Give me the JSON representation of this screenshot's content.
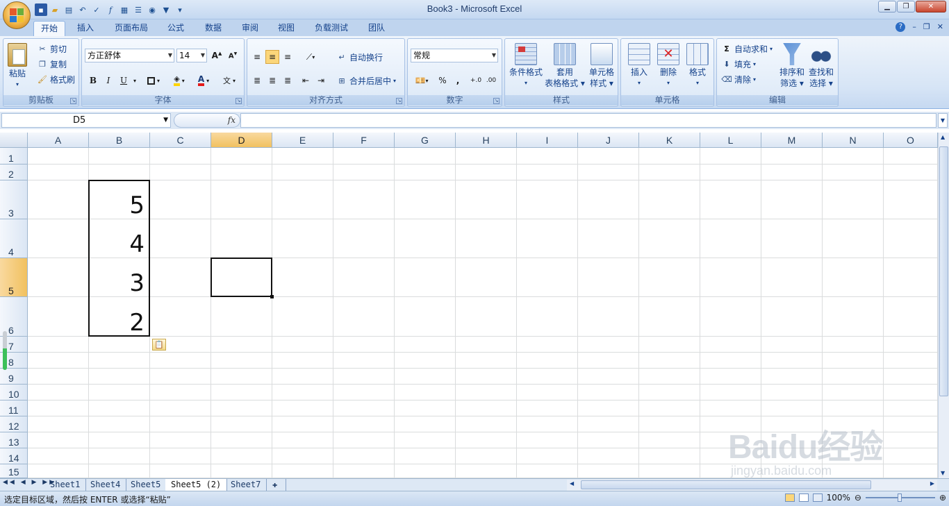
{
  "window": {
    "title": "Book3 - Microsoft Excel"
  },
  "ribbon_tabs": [
    "开始",
    "插入",
    "页面布局",
    "公式",
    "数据",
    "审阅",
    "视图",
    "负载测试",
    "团队"
  ],
  "clipboard": {
    "paste": "粘贴",
    "cut": "剪切",
    "copy": "复制",
    "format_painter": "格式刷",
    "label": "剪贴板"
  },
  "font": {
    "name": "方正舒体",
    "size": "14",
    "bold": "B",
    "italic": "I",
    "underline": "U",
    "label": "字体"
  },
  "alignment": {
    "wrap_text": "自动换行",
    "merge_center": "合并后居中",
    "label": "对齐方式"
  },
  "number": {
    "format": "常规",
    "percent": "%",
    "comma": ",",
    "label": "数字"
  },
  "styles": {
    "conditional": "条件格式",
    "table_format_1": "套用",
    "table_format_2": "表格格式",
    "cell_styles_1": "单元格",
    "cell_styles_2": "样式",
    "label": "样式"
  },
  "cells": {
    "insert": "插入",
    "delete": "删除",
    "format": "格式",
    "label": "单元格"
  },
  "editing": {
    "autosum": "自动求和",
    "fill": "填充",
    "clear": "清除",
    "sort_1": "排序和",
    "sort_2": "筛选",
    "find_1": "查找和",
    "find_2": "选择",
    "label": "编辑"
  },
  "formula_bar": {
    "name_box": "D5",
    "fx": "fx",
    "value": ""
  },
  "columns": [
    "A",
    "B",
    "C",
    "D",
    "E",
    "F",
    "G",
    "H",
    "I",
    "J",
    "K",
    "L",
    "M",
    "N",
    "O"
  ],
  "rows": [
    "1",
    "2",
    "3",
    "4",
    "5",
    "6",
    "7",
    "8",
    "9",
    "10",
    "11",
    "12",
    "13",
    "14",
    "15"
  ],
  "selected_cell": "D5",
  "cell_values": [
    {
      "cell": "B3",
      "value": "5"
    },
    {
      "cell": "B4",
      "value": "4"
    },
    {
      "cell": "B5",
      "value": "3"
    },
    {
      "cell": "B6",
      "value": "2"
    }
  ],
  "sheets": [
    "Sheet1",
    "Sheet4",
    "Sheet5",
    "Sheet5 (2)",
    "Sheet7"
  ],
  "active_sheet": "Sheet5 (2)",
  "status": {
    "message": "选定目标区域，然后按 ENTER 或选择“粘贴”",
    "zoom": "100%"
  },
  "watermark": {
    "brand": "Baidu经验",
    "url": "jingyan.baidu.com"
  }
}
